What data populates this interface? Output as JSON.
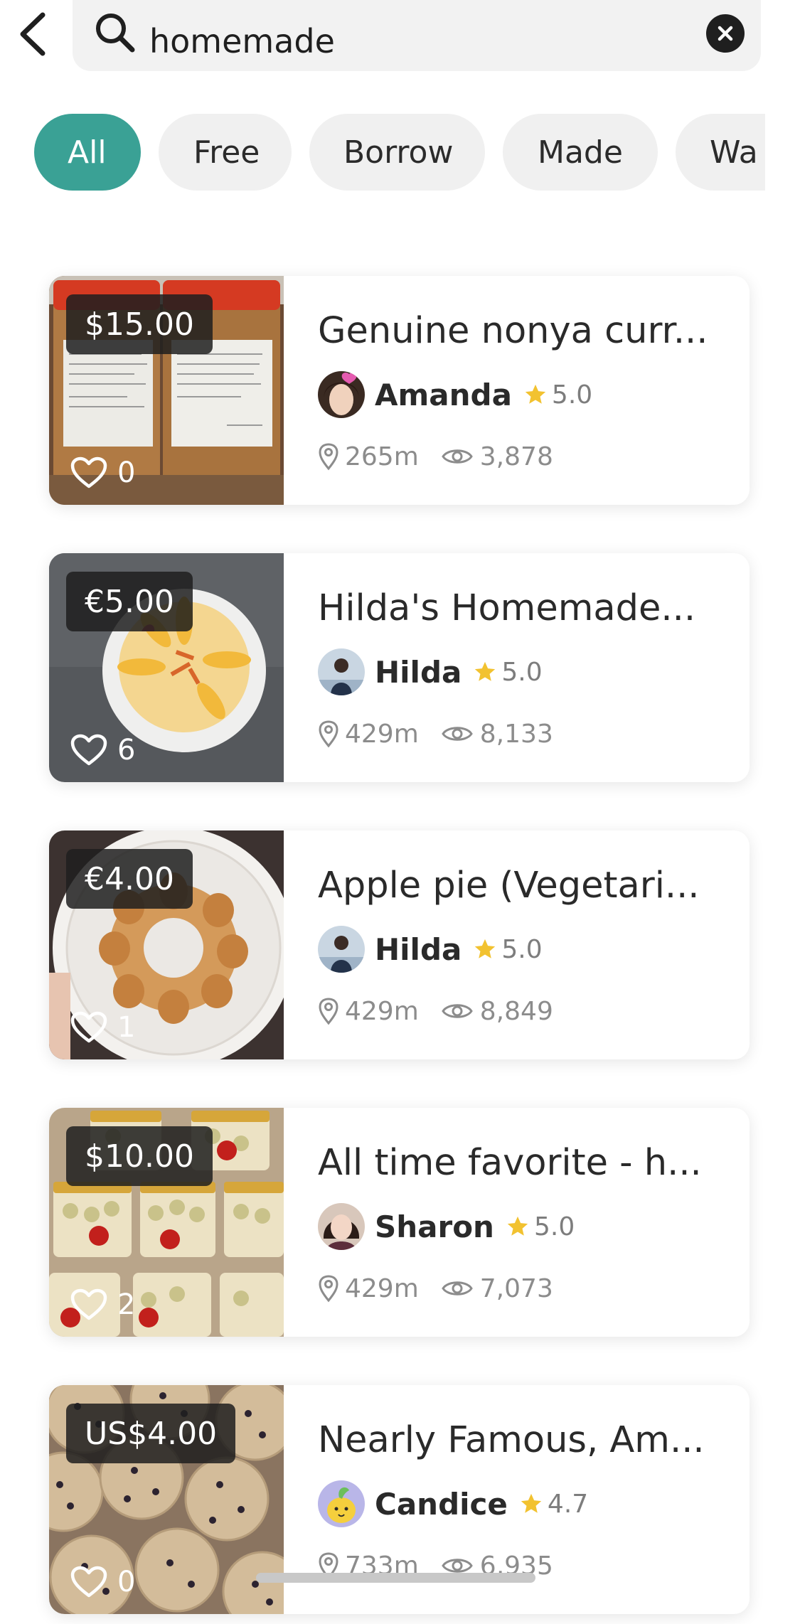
{
  "search": {
    "value": "homemade"
  },
  "filters": [
    {
      "label": "All",
      "active": true
    },
    {
      "label": "Free",
      "active": false
    },
    {
      "label": "Borrow",
      "active": false
    },
    {
      "label": "Made",
      "active": false
    },
    {
      "label": "Wa",
      "active": false
    }
  ],
  "listings": [
    {
      "price": "$15.00",
      "likes": "0",
      "title": "Genuine nonya curr...",
      "seller": "Amanda",
      "rating": "5.0",
      "distance": "265m",
      "views": "3,878"
    },
    {
      "price": "€5.00",
      "likes": "6",
      "title": "Hilda's Homemade...",
      "seller": "Hilda",
      "rating": "5.0",
      "distance": "429m",
      "views": "8,133"
    },
    {
      "price": "€4.00",
      "likes": "1",
      "title": "Apple pie (Vegetari...",
      "seller": "Hilda",
      "rating": "5.0",
      "distance": "429m",
      "views": "8,849"
    },
    {
      "price": "$10.00",
      "likes": "2",
      "title": "All time favorite - h...",
      "seller": "Sharon",
      "rating": "5.0",
      "distance": "429m",
      "views": "7,073"
    },
    {
      "price": "US$4.00",
      "likes": "0",
      "title": "Nearly Famous, Am...",
      "seller": "Candice",
      "rating": "4.7",
      "distance": "733m",
      "views": "6,935"
    }
  ],
  "icons": {
    "back": "chevron-left-icon",
    "search": "search-icon",
    "clear": "close-icon",
    "like": "heart-icon",
    "rating": "star-icon",
    "distance": "location-pin-icon",
    "views": "eye-icon"
  },
  "colors": {
    "accent": "#3aa195",
    "star": "#f2c230",
    "chip_bg": "#f0f0f0"
  }
}
